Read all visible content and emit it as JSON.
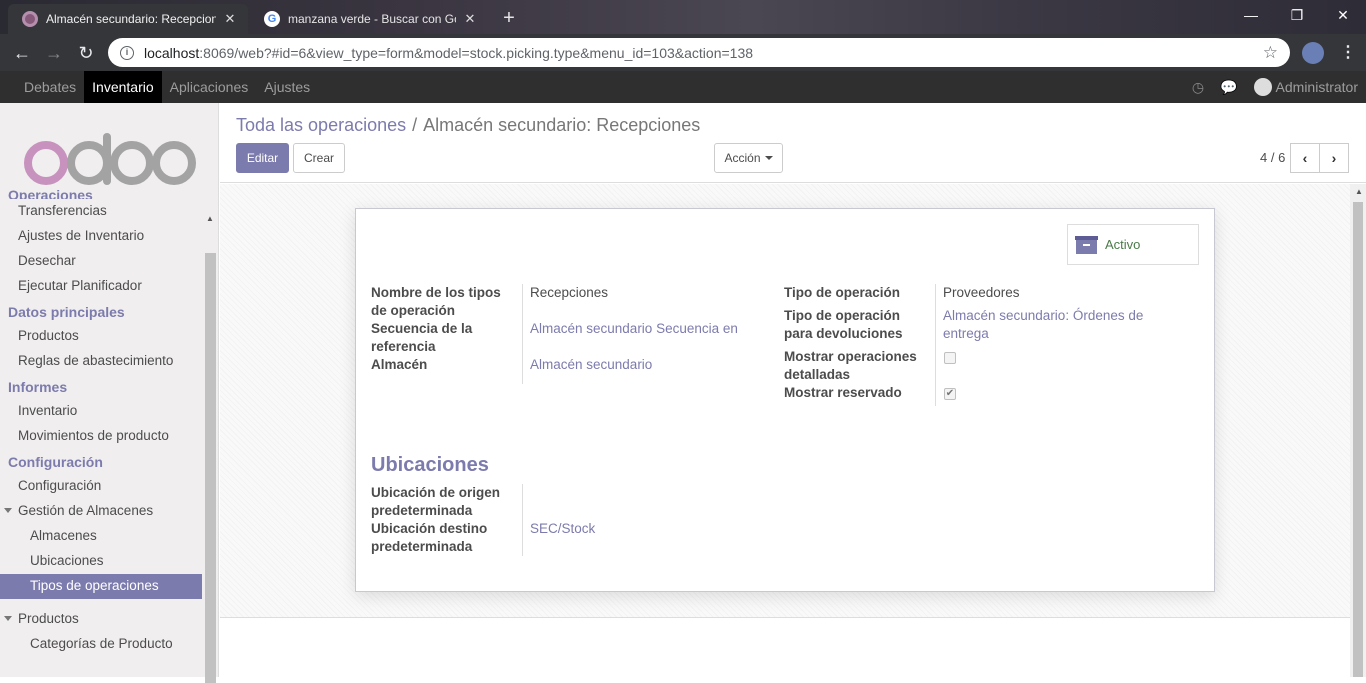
{
  "browser": {
    "tabs": [
      {
        "title": "Almacén secundario: Recepciones",
        "active": true,
        "icon": "odoo-favicon"
      },
      {
        "title": "manzana verde - Buscar con Google",
        "active": false,
        "icon": "google-favicon"
      }
    ],
    "url_host": "localhost",
    "url_rest": ":8069/web?#id=6&view_type=form&model=stock.picking.type&menu_id=103&action=138"
  },
  "topnav": {
    "items": [
      "Debates",
      "Inventario",
      "Aplicaciones",
      "Ajustes"
    ],
    "active": "Inventario",
    "user": "Administrator"
  },
  "sidebar": {
    "cut_section": "Operaciones",
    "groups": [
      {
        "items": [
          "Transferencias",
          "Ajustes de Inventario",
          "Desechar",
          "Ejecutar Planificador"
        ]
      },
      {
        "title": "Datos principales",
        "items": [
          "Productos",
          "Reglas de abastecimiento"
        ]
      },
      {
        "title": "Informes",
        "items": [
          "Inventario",
          "Movimientos de producto"
        ]
      },
      {
        "title": "Configuración",
        "items": [
          "Configuración",
          "Gestión de Almacenes",
          "Almacenes",
          "Ubicaciones",
          "Tipos de operaciones",
          "Productos",
          "Categorías de Producto"
        ]
      }
    ],
    "active_item": "Tipos de operaciones"
  },
  "control_panel": {
    "breadcrumb_parent": "Toda las operaciones",
    "breadcrumb_current": "Almacén secundario: Recepciones",
    "edit_label": "Editar",
    "create_label": "Crear",
    "action_label": "Acción",
    "pager": "4 / 6"
  },
  "form": {
    "archive_label": "Activo",
    "left_fields": [
      {
        "label": "Nombre de los tipos de operación",
        "value": "Recepciones"
      },
      {
        "label": "Secuencia de la referencia",
        "value": "Almacén secundario Secuencia en"
      },
      {
        "label": "Almacén",
        "value": "Almacén secundario"
      }
    ],
    "right_fields": [
      {
        "label": "Tipo de operación",
        "value": "Proveedores"
      },
      {
        "label": "Tipo de operación para devoluciones",
        "value": "Almacén secundario: Órdenes de entrega"
      },
      {
        "label": "Mostrar operaciones detalladas",
        "checked": false
      },
      {
        "label": "Mostrar reservado",
        "checked": true
      }
    ],
    "section_title": "Ubicaciones",
    "location_fields": [
      {
        "label": "Ubicación de origen predeterminada",
        "value": ""
      },
      {
        "label": "Ubicación destino predeterminada",
        "value": "SEC/Stock"
      }
    ]
  }
}
